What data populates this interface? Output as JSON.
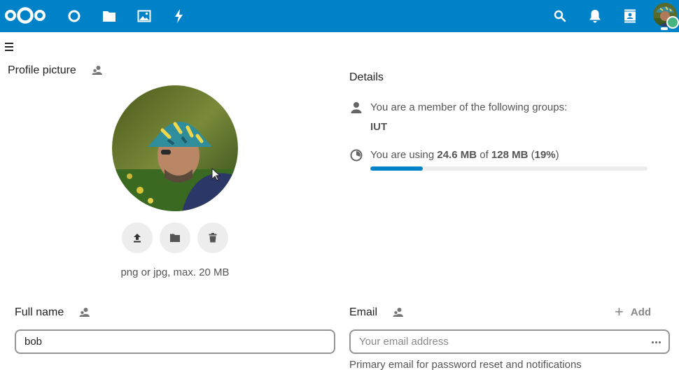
{
  "header": {
    "logo": "nextcloud-logo",
    "apps": [
      {
        "name": "dashboard",
        "icon": "dashboard-icon"
      },
      {
        "name": "files",
        "icon": "folder-icon"
      },
      {
        "name": "photos",
        "icon": "image-icon"
      },
      {
        "name": "activity",
        "icon": "lightning-icon"
      }
    ],
    "right": [
      {
        "name": "search",
        "icon": "search-icon"
      },
      {
        "name": "notifications",
        "icon": "bell-icon"
      },
      {
        "name": "contacts",
        "icon": "contacts-icon"
      }
    ],
    "colors": {
      "brand": "#0082c9",
      "status": "#49b382"
    }
  },
  "profile_picture": {
    "title": "Profile picture",
    "hint": "png or jpg, max. 20 MB",
    "buttons": [
      "upload-icon",
      "folder-icon",
      "trash-icon"
    ]
  },
  "details": {
    "title": "Details",
    "groups_label": "You are a member of the following groups:",
    "groups": "IUT",
    "quota": {
      "prefix": "You are using ",
      "used": "24.6 MB",
      "of": " of ",
      "total": "128 MB",
      "paren_open": " (",
      "percent": "19%",
      "paren_close": ")",
      "fraction": 0.19
    }
  },
  "full_name": {
    "label": "Full name",
    "value": "bob"
  },
  "email": {
    "label": "Email",
    "add_label": "Add",
    "placeholder": "Your email address",
    "hint": "Primary email for password reset and notifications"
  }
}
